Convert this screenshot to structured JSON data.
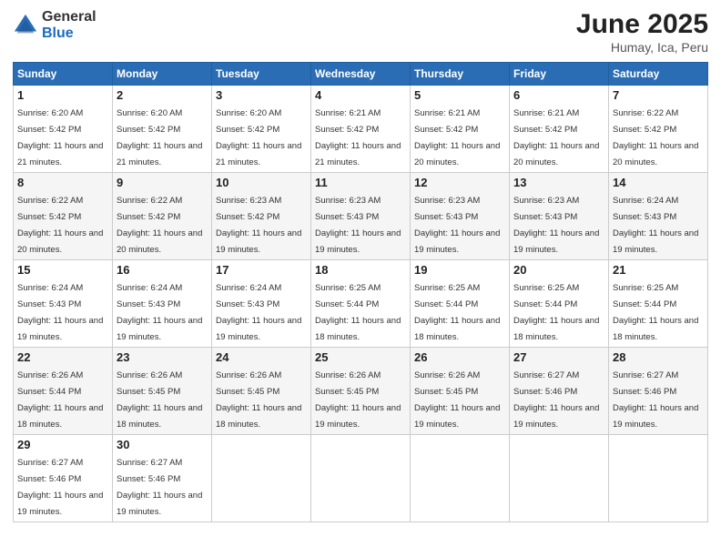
{
  "logo": {
    "general": "General",
    "blue": "Blue"
  },
  "title": {
    "month": "June 2025",
    "location": "Humay, Ica, Peru"
  },
  "weekdays": [
    "Sunday",
    "Monday",
    "Tuesday",
    "Wednesday",
    "Thursday",
    "Friday",
    "Saturday"
  ],
  "weeks": [
    [
      {
        "day": "1",
        "sunrise": "Sunrise: 6:20 AM",
        "sunset": "Sunset: 5:42 PM",
        "daylight": "Daylight: 11 hours and 21 minutes."
      },
      {
        "day": "2",
        "sunrise": "Sunrise: 6:20 AM",
        "sunset": "Sunset: 5:42 PM",
        "daylight": "Daylight: 11 hours and 21 minutes."
      },
      {
        "day": "3",
        "sunrise": "Sunrise: 6:20 AM",
        "sunset": "Sunset: 5:42 PM",
        "daylight": "Daylight: 11 hours and 21 minutes."
      },
      {
        "day": "4",
        "sunrise": "Sunrise: 6:21 AM",
        "sunset": "Sunset: 5:42 PM",
        "daylight": "Daylight: 11 hours and 21 minutes."
      },
      {
        "day": "5",
        "sunrise": "Sunrise: 6:21 AM",
        "sunset": "Sunset: 5:42 PM",
        "daylight": "Daylight: 11 hours and 20 minutes."
      },
      {
        "day": "6",
        "sunrise": "Sunrise: 6:21 AM",
        "sunset": "Sunset: 5:42 PM",
        "daylight": "Daylight: 11 hours and 20 minutes."
      },
      {
        "day": "7",
        "sunrise": "Sunrise: 6:22 AM",
        "sunset": "Sunset: 5:42 PM",
        "daylight": "Daylight: 11 hours and 20 minutes."
      }
    ],
    [
      {
        "day": "8",
        "sunrise": "Sunrise: 6:22 AM",
        "sunset": "Sunset: 5:42 PM",
        "daylight": "Daylight: 11 hours and 20 minutes."
      },
      {
        "day": "9",
        "sunrise": "Sunrise: 6:22 AM",
        "sunset": "Sunset: 5:42 PM",
        "daylight": "Daylight: 11 hours and 20 minutes."
      },
      {
        "day": "10",
        "sunrise": "Sunrise: 6:23 AM",
        "sunset": "Sunset: 5:42 PM",
        "daylight": "Daylight: 11 hours and 19 minutes."
      },
      {
        "day": "11",
        "sunrise": "Sunrise: 6:23 AM",
        "sunset": "Sunset: 5:43 PM",
        "daylight": "Daylight: 11 hours and 19 minutes."
      },
      {
        "day": "12",
        "sunrise": "Sunrise: 6:23 AM",
        "sunset": "Sunset: 5:43 PM",
        "daylight": "Daylight: 11 hours and 19 minutes."
      },
      {
        "day": "13",
        "sunrise": "Sunrise: 6:23 AM",
        "sunset": "Sunset: 5:43 PM",
        "daylight": "Daylight: 11 hours and 19 minutes."
      },
      {
        "day": "14",
        "sunrise": "Sunrise: 6:24 AM",
        "sunset": "Sunset: 5:43 PM",
        "daylight": "Daylight: 11 hours and 19 minutes."
      }
    ],
    [
      {
        "day": "15",
        "sunrise": "Sunrise: 6:24 AM",
        "sunset": "Sunset: 5:43 PM",
        "daylight": "Daylight: 11 hours and 19 minutes."
      },
      {
        "day": "16",
        "sunrise": "Sunrise: 6:24 AM",
        "sunset": "Sunset: 5:43 PM",
        "daylight": "Daylight: 11 hours and 19 minutes."
      },
      {
        "day": "17",
        "sunrise": "Sunrise: 6:24 AM",
        "sunset": "Sunset: 5:43 PM",
        "daylight": "Daylight: 11 hours and 19 minutes."
      },
      {
        "day": "18",
        "sunrise": "Sunrise: 6:25 AM",
        "sunset": "Sunset: 5:44 PM",
        "daylight": "Daylight: 11 hours and 18 minutes."
      },
      {
        "day": "19",
        "sunrise": "Sunrise: 6:25 AM",
        "sunset": "Sunset: 5:44 PM",
        "daylight": "Daylight: 11 hours and 18 minutes."
      },
      {
        "day": "20",
        "sunrise": "Sunrise: 6:25 AM",
        "sunset": "Sunset: 5:44 PM",
        "daylight": "Daylight: 11 hours and 18 minutes."
      },
      {
        "day": "21",
        "sunrise": "Sunrise: 6:25 AM",
        "sunset": "Sunset: 5:44 PM",
        "daylight": "Daylight: 11 hours and 18 minutes."
      }
    ],
    [
      {
        "day": "22",
        "sunrise": "Sunrise: 6:26 AM",
        "sunset": "Sunset: 5:44 PM",
        "daylight": "Daylight: 11 hours and 18 minutes."
      },
      {
        "day": "23",
        "sunrise": "Sunrise: 6:26 AM",
        "sunset": "Sunset: 5:45 PM",
        "daylight": "Daylight: 11 hours and 18 minutes."
      },
      {
        "day": "24",
        "sunrise": "Sunrise: 6:26 AM",
        "sunset": "Sunset: 5:45 PM",
        "daylight": "Daylight: 11 hours and 18 minutes."
      },
      {
        "day": "25",
        "sunrise": "Sunrise: 6:26 AM",
        "sunset": "Sunset: 5:45 PM",
        "daylight": "Daylight: 11 hours and 19 minutes."
      },
      {
        "day": "26",
        "sunrise": "Sunrise: 6:26 AM",
        "sunset": "Sunset: 5:45 PM",
        "daylight": "Daylight: 11 hours and 19 minutes."
      },
      {
        "day": "27",
        "sunrise": "Sunrise: 6:27 AM",
        "sunset": "Sunset: 5:46 PM",
        "daylight": "Daylight: 11 hours and 19 minutes."
      },
      {
        "day": "28",
        "sunrise": "Sunrise: 6:27 AM",
        "sunset": "Sunset: 5:46 PM",
        "daylight": "Daylight: 11 hours and 19 minutes."
      }
    ],
    [
      {
        "day": "29",
        "sunrise": "Sunrise: 6:27 AM",
        "sunset": "Sunset: 5:46 PM",
        "daylight": "Daylight: 11 hours and 19 minutes."
      },
      {
        "day": "30",
        "sunrise": "Sunrise: 6:27 AM",
        "sunset": "Sunset: 5:46 PM",
        "daylight": "Daylight: 11 hours and 19 minutes."
      },
      {
        "day": "",
        "sunrise": "",
        "sunset": "",
        "daylight": ""
      },
      {
        "day": "",
        "sunrise": "",
        "sunset": "",
        "daylight": ""
      },
      {
        "day": "",
        "sunrise": "",
        "sunset": "",
        "daylight": ""
      },
      {
        "day": "",
        "sunrise": "",
        "sunset": "",
        "daylight": ""
      },
      {
        "day": "",
        "sunrise": "",
        "sunset": "",
        "daylight": ""
      }
    ]
  ]
}
